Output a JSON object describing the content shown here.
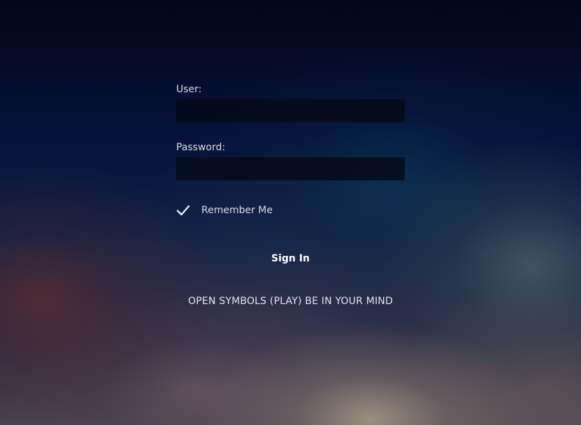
{
  "login": {
    "user_label": "User:",
    "user_value": "",
    "password_label": "Password:",
    "password_value": "",
    "remember_label": "Remember Me",
    "remember_checked": true,
    "sign_in_label": "Sign In",
    "message": "OPEN SYMBOLS (PLAY) BE IN YOUR MIND"
  },
  "icons": {
    "remember_check": "check-icon"
  },
  "colors": {
    "background_top": "#030716",
    "background_bottom": "#4a4350",
    "input_background": "#040a16",
    "text": "#d9dde4"
  }
}
